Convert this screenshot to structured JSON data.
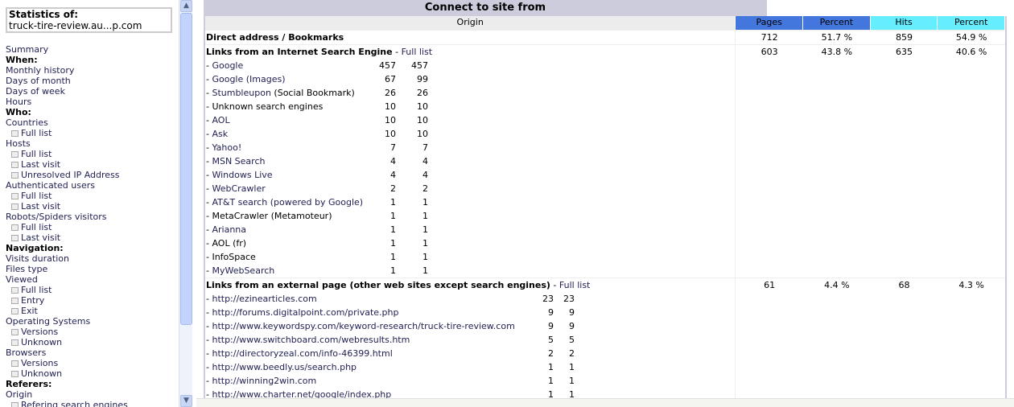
{
  "sidebar": {
    "stats_label": "Statistics of:",
    "site": "truck-tire-review.au...p.com",
    "items": [
      {
        "label": "Summary",
        "type": "link"
      },
      {
        "label": "When:",
        "type": "heading"
      },
      {
        "label": "Monthly history",
        "type": "link"
      },
      {
        "label": "Days of month",
        "type": "link"
      },
      {
        "label": "Days of week",
        "type": "link"
      },
      {
        "label": "Hours",
        "type": "link"
      },
      {
        "label": "Who:",
        "type": "heading"
      },
      {
        "label": "Countries",
        "type": "link"
      },
      {
        "label": "Full list",
        "type": "sub"
      },
      {
        "label": "Hosts",
        "type": "link"
      },
      {
        "label": "Full list",
        "type": "sub"
      },
      {
        "label": "Last visit",
        "type": "sub"
      },
      {
        "label": "Unresolved IP Address",
        "type": "sub"
      },
      {
        "label": "Authenticated users",
        "type": "link"
      },
      {
        "label": "Full list",
        "type": "sub"
      },
      {
        "label": "Last visit",
        "type": "sub"
      },
      {
        "label": "Robots/Spiders visitors",
        "type": "link"
      },
      {
        "label": "Full list",
        "type": "sub"
      },
      {
        "label": "Last visit",
        "type": "sub"
      },
      {
        "label": "Navigation:",
        "type": "heading"
      },
      {
        "label": "Visits duration",
        "type": "link"
      },
      {
        "label": "Files type",
        "type": "link"
      },
      {
        "label": "Viewed",
        "type": "link"
      },
      {
        "label": "Full list",
        "type": "sub"
      },
      {
        "label": "Entry",
        "type": "sub"
      },
      {
        "label": "Exit",
        "type": "sub"
      },
      {
        "label": "Operating Systems",
        "type": "link"
      },
      {
        "label": "Versions",
        "type": "sub"
      },
      {
        "label": "Unknown",
        "type": "sub"
      },
      {
        "label": "Browsers",
        "type": "link"
      },
      {
        "label": "Versions",
        "type": "sub"
      },
      {
        "label": "Unknown",
        "type": "sub"
      },
      {
        "label": "Referers:",
        "type": "heading"
      },
      {
        "label": "Origin",
        "type": "link"
      },
      {
        "label": "Refering search engines",
        "type": "sub"
      }
    ]
  },
  "main": {
    "title": "Connect to site from",
    "headers": {
      "origin": "Origin",
      "pages": "Pages",
      "percent1": "Percent",
      "hits": "Hits",
      "percent2": "Percent"
    },
    "colors": {
      "pages": "#4477dd",
      "hits": "#66eeff",
      "title": "#ccccdd"
    },
    "direct": {
      "label": "Direct address / Bookmarks",
      "pages": "712",
      "percent_pages": "51.7 %",
      "hits": "859",
      "percent_hits": "54.9 %"
    },
    "search": {
      "label": "Links from an Internet Search Engine",
      "full_list": "Full list",
      "pages": "603",
      "percent_pages": "43.8 %",
      "hits": "635",
      "percent_hits": "40.6 %",
      "rows": [
        {
          "name": "Google",
          "link": true,
          "pages": "457",
          "hits": "457"
        },
        {
          "name": "Google (Images)",
          "link": true,
          "pages": "67",
          "hits": "99"
        },
        {
          "name": "Stumbleupon",
          "suffix": " (Social Bookmark)",
          "link": true,
          "pages": "26",
          "hits": "26"
        },
        {
          "name": "Unknown search engines",
          "link": false,
          "pages": "10",
          "hits": "10"
        },
        {
          "name": "AOL",
          "link": true,
          "pages": "10",
          "hits": "10"
        },
        {
          "name": "Ask",
          "link": true,
          "pages": "10",
          "hits": "10"
        },
        {
          "name": "Yahoo!",
          "link": true,
          "pages": "7",
          "hits": "7"
        },
        {
          "name": "MSN Search",
          "link": true,
          "pages": "4",
          "hits": "4"
        },
        {
          "name": "Windows Live",
          "link": true,
          "pages": "4",
          "hits": "4"
        },
        {
          "name": "WebCrawler",
          "link": true,
          "pages": "2",
          "hits": "2"
        },
        {
          "name": "AT&T search (powered by Google)",
          "link": true,
          "pages": "1",
          "hits": "1"
        },
        {
          "name": "MetaCrawler (Metamoteur)",
          "link": false,
          "pages": "1",
          "hits": "1"
        },
        {
          "name": "Arianna",
          "link": true,
          "pages": "1",
          "hits": "1"
        },
        {
          "name": "AOL (fr)",
          "link": false,
          "pages": "1",
          "hits": "1"
        },
        {
          "name": "InfoSpace",
          "link": false,
          "pages": "1",
          "hits": "1"
        },
        {
          "name": "MyWebSearch",
          "link": true,
          "pages": "1",
          "hits": "1"
        }
      ]
    },
    "external": {
      "label": "Links from an external page (other web sites except search engines)",
      "full_list": "Full list",
      "pages": "61",
      "percent_pages": "4.4 %",
      "hits": "68",
      "percent_hits": "4.3 %",
      "rows": [
        {
          "name": "http://ezinearticles.com",
          "link": true,
          "pages": "23",
          "hits": "23"
        },
        {
          "name": "http://forums.digitalpoint.com/private.php",
          "link": true,
          "pages": "9",
          "hits": "9"
        },
        {
          "name": "http://www.keywordspy.com/keyword-research/truck-tire-review.com",
          "link": true,
          "pages": "9",
          "hits": "9"
        },
        {
          "name": "http://www.switchboard.com/webresults.htm",
          "link": true,
          "pages": "5",
          "hits": "5"
        },
        {
          "name": "http://directoryzeal.com/info-46399.html",
          "link": true,
          "pages": "2",
          "hits": "2"
        },
        {
          "name": "http://www.beedly.us/search.php",
          "link": true,
          "pages": "1",
          "hits": "1"
        },
        {
          "name": "http://winning2win.com",
          "link": true,
          "pages": "1",
          "hits": "1"
        },
        {
          "name": "http://www.charter.net/google/index.php",
          "link": true,
          "pages": "1",
          "hits": "1"
        }
      ]
    }
  }
}
